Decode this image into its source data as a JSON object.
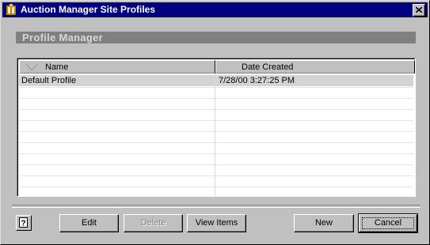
{
  "window": {
    "title": "Auction Manager Site Profiles"
  },
  "section": {
    "title": "Profile Manager"
  },
  "list": {
    "columns": [
      "Name",
      "Date Created"
    ],
    "rows": [
      {
        "name": "Default Profile",
        "date_created": "7/28/00 3:27:25 PM",
        "selected": true
      }
    ]
  },
  "buttons": {
    "edit": "Edit",
    "delete": "Delete",
    "view_items": "View Items",
    "new": "New",
    "cancel": "Cancel"
  },
  "icons": {
    "app": "auction-app-icon",
    "close": "close-icon",
    "help": "help-icon",
    "sort": "sort-arrow-icon"
  }
}
